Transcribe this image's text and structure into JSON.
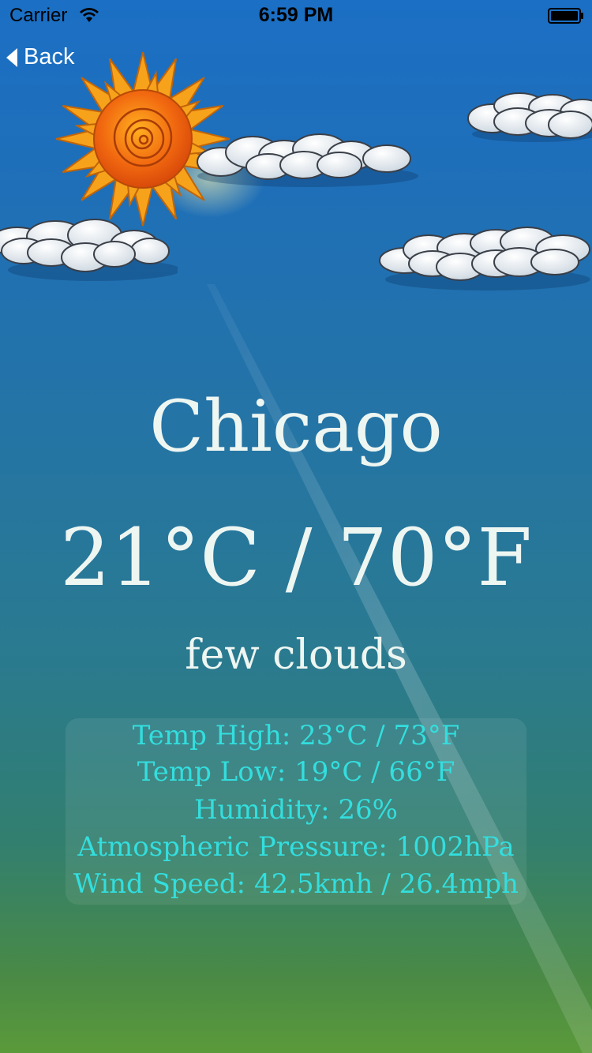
{
  "status_bar": {
    "carrier": "Carrier",
    "time": "6:59 PM"
  },
  "nav": {
    "back_label": "Back"
  },
  "weather": {
    "city": "Chicago",
    "temperature": "21°C / 70°F",
    "description": "few clouds"
  },
  "details": {
    "temp_high": "Temp High: 23°C / 73°F",
    "temp_low": "Temp Low: 19°C / 66°F",
    "humidity": "Humidity: 26%",
    "pressure": "Atmospheric Pressure: 1002hPa",
    "wind_speed": "Wind Speed: 42.5kmh / 26.4mph"
  },
  "colors": {
    "sky_top": "#1b6fc4",
    "ground": "#5b9a3a",
    "detail_text": "#33dede",
    "main_text": "#eef6f2"
  },
  "icons": [
    "wifi-icon",
    "battery-icon",
    "back-chevron-icon",
    "sun-icon",
    "cloud-icon"
  ]
}
